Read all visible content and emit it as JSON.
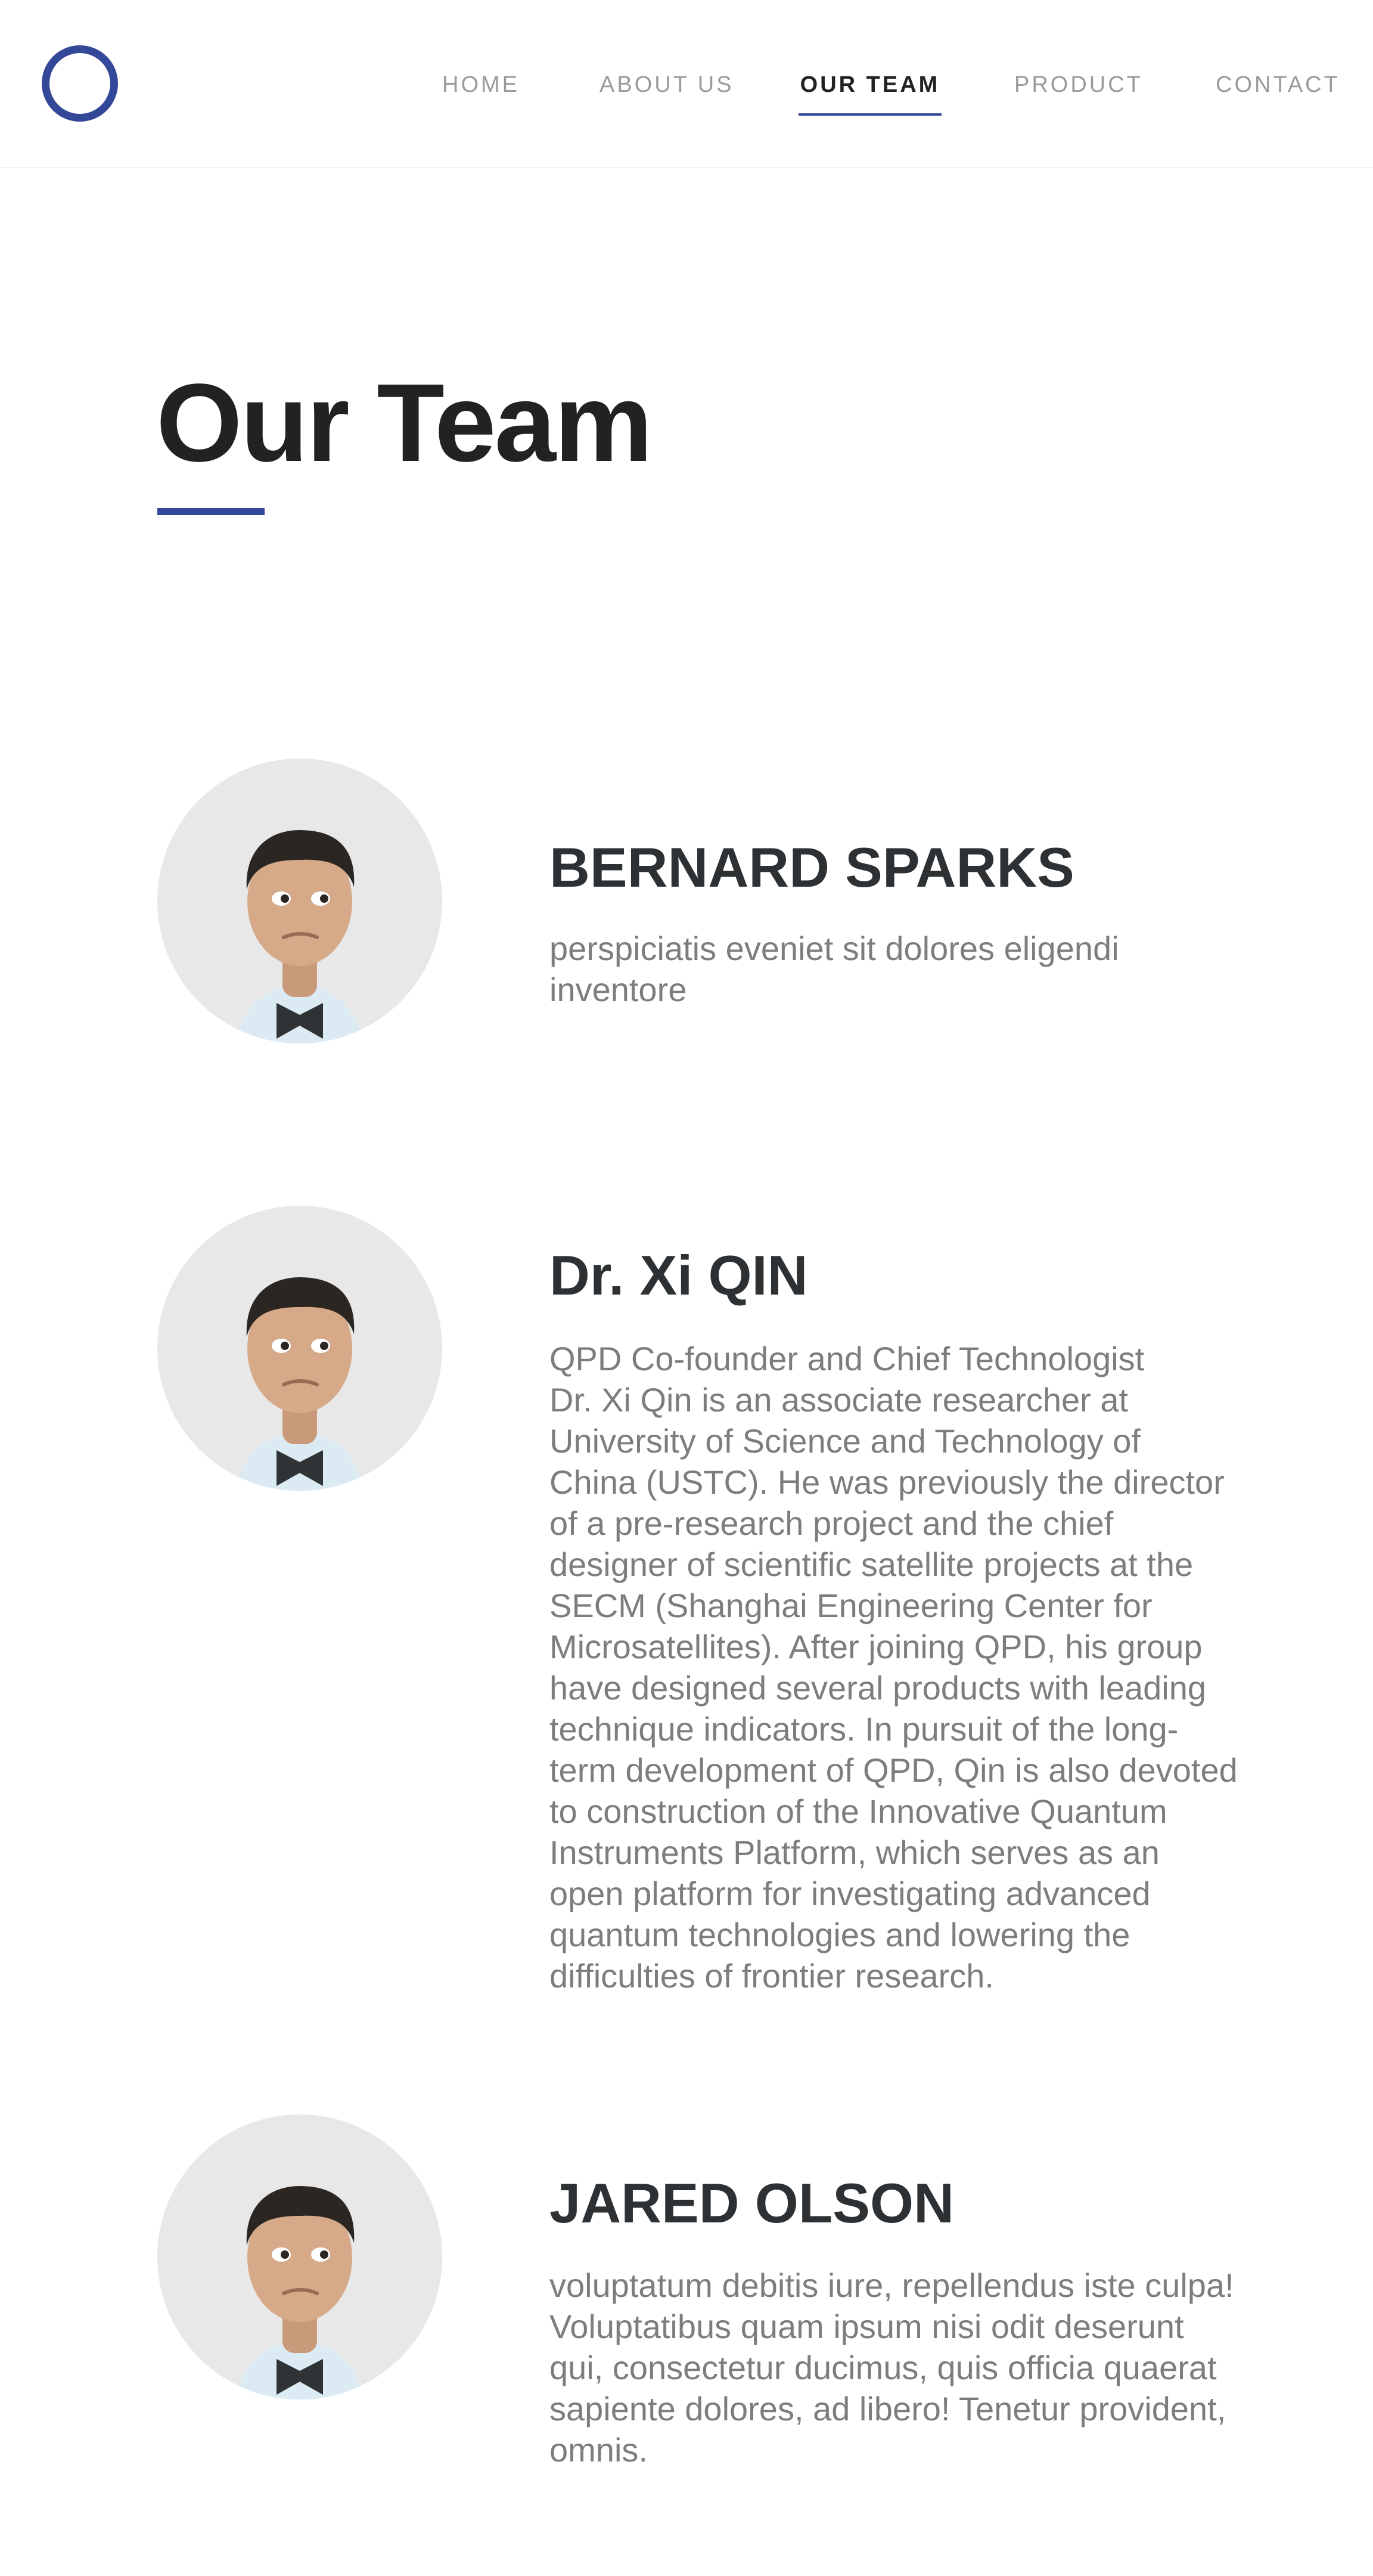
{
  "nav": {
    "logo_icon": "circle-logo-icon",
    "items": [
      {
        "label": "HOME"
      },
      {
        "label": "ABOUT US"
      },
      {
        "label": "OUR TEAM",
        "active": true
      },
      {
        "label": "PRODUCT"
      },
      {
        "label": "CONTACT"
      }
    ]
  },
  "page": {
    "title": "Our Team"
  },
  "team": [
    {
      "name": "BERNARD SPARKS",
      "bio": " perspiciatis eveniet sit dolores eligendi\ninventore"
    },
    {
      "name": "Dr. Xi QIN",
      "bio": "QPD Co-founder and Chief Technologist\nDr. Xi Qin is an associate researcher at\nUniversity of Science and Technology of\nChina (USTC). He was previously the director\nof a pre-research project and the chief\ndesigner of scientific satellite projects at the\nSECM (Shanghai Engineering Center for\nMicrosatellites). After joining QPD, his group\nhave designed several products with leading\ntechnique indicators. In pursuit of the long-\nterm development of QPD, Qin is also devoted\nto construction of the Innovative Quantum\nInstruments Platform, which serves as an\nopen platform for investigating advanced\nquantum technologies and lowering the\ndifficulties of frontier research."
    },
    {
      "name": "JARED OLSON",
      "bio": "voluptatum debitis iure, repellendus iste culpa!\nVoluptatibus quam ipsum nisi odit deserunt\nqui, consectetur ducimus, quis officia quaerat\nsapiente dolores, ad libero! Tenetur provident,\nomnis."
    }
  ],
  "colors": {
    "accent": "#34489a",
    "heading": "#222222",
    "name": "#2e3133",
    "body_text": "#7d7d7d",
    "nav_inactive": "#9a9a9a"
  }
}
